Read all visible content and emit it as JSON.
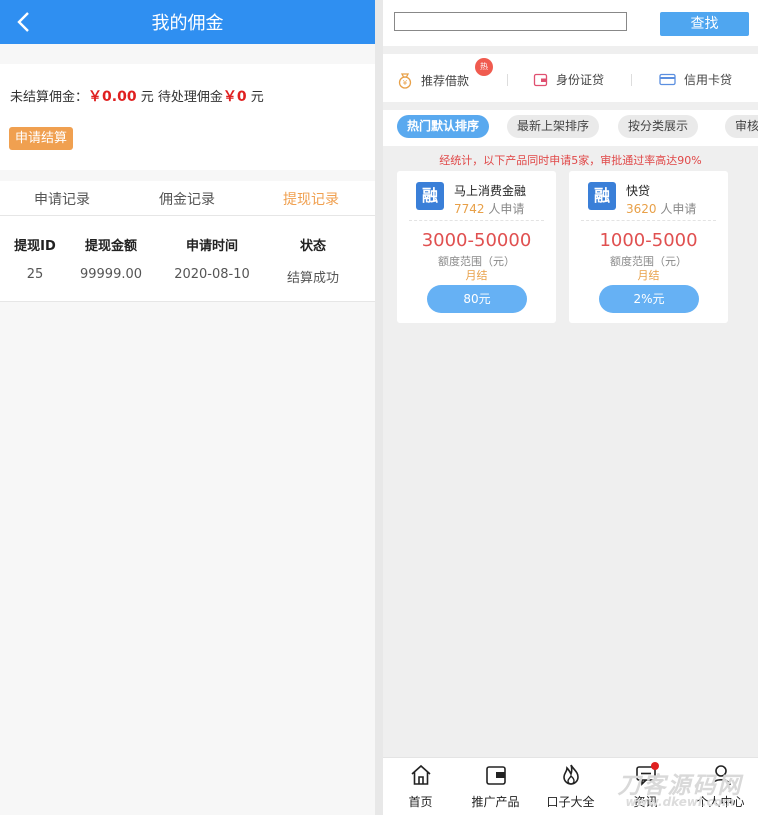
{
  "commission_page": {
    "title": "我的佣金",
    "summary": {
      "unsettled_label": "未结算佣金：",
      "unsettled_value": "￥0.00",
      "unit1": "元",
      "pending_label": "待处理佣金",
      "pending_value": "￥0",
      "unit2": "元"
    },
    "apply_button": "申请结算",
    "tabs": [
      "申请记录",
      "佣金记录",
      "提现记录"
    ],
    "active_tab_index": 2,
    "table": {
      "headers": [
        "提现ID",
        "提现金额",
        "申请时间",
        "状态"
      ],
      "rows": [
        [
          "25",
          "99999.00",
          "2020-08-10",
          "结算成功"
        ]
      ]
    }
  },
  "home_page": {
    "search": {
      "value": "",
      "button": "查找"
    },
    "quick_links": [
      {
        "label": "推荐借款",
        "icon": "money-bag-icon"
      },
      {
        "label": "身份证贷",
        "icon": "wallet-icon"
      },
      {
        "label": "信用卡贷",
        "icon": "credit-card-icon"
      }
    ],
    "hot_badge": "热",
    "sort_tabs": [
      "热门默认排序",
      "最新上架排序",
      "按分类展示",
      "审核"
    ],
    "active_sort_index": 0,
    "notice": "经统计，以下产品同时申请5家，审批通过率高达90%",
    "products": [
      {
        "logo": "融",
        "name": "马上消费金融",
        "count": "7742",
        "count_suffix": "人申请",
        "range": "3000-50000",
        "range_label": "额度范围（元）",
        "term": "月结",
        "button": "80元"
      },
      {
        "logo": "融",
        "name": "快贷",
        "count": "3620",
        "count_suffix": "人申请",
        "range": "1000-5000",
        "range_label": "额度范围（元）",
        "term": "月结",
        "button": "2%元"
      }
    ],
    "bottom_nav": [
      {
        "label": "首页",
        "icon": "home-icon"
      },
      {
        "label": "推广产品",
        "icon": "wallet-icon"
      },
      {
        "label": "口子大全",
        "icon": "fire-icon"
      },
      {
        "label": "资讯",
        "icon": "message-icon"
      },
      {
        "label": "个人中心",
        "icon": "user-icon"
      }
    ],
    "watermark": {
      "main": "刀客源码网",
      "url": "www.dkewl.com"
    }
  },
  "colors": {
    "primary": "#2f8ff1",
    "accent": "#f0a050",
    "danger": "#e02020",
    "button_blue": "#66b1f4"
  }
}
